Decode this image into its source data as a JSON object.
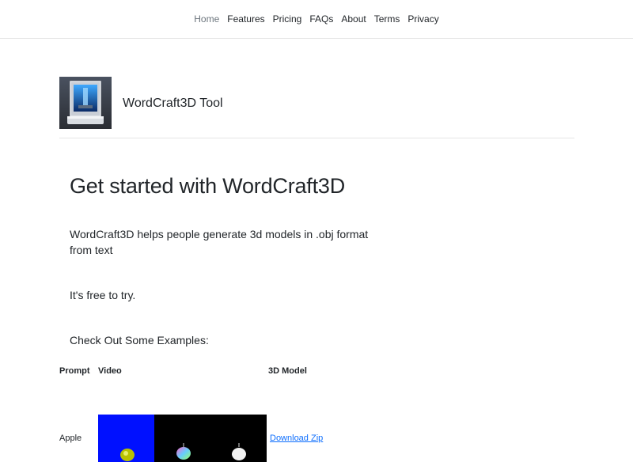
{
  "nav": {
    "items": [
      {
        "label": "Home",
        "active": true
      },
      {
        "label": "Features",
        "active": false
      },
      {
        "label": "Pricing",
        "active": false
      },
      {
        "label": "FAQs",
        "active": false
      },
      {
        "label": "About",
        "active": false
      },
      {
        "label": "Terms",
        "active": false
      },
      {
        "label": "Privacy",
        "active": false
      }
    ]
  },
  "brand": {
    "name": "WordCraft3D Tool",
    "logo_icon": "3d-printer-icon"
  },
  "hero": {
    "title": "Get started with WordCraft3D",
    "description": "WordCraft3D helps people generate 3d models in .obj format from text",
    "free_note": "It's free to try.",
    "examples_heading": "Check Out Some Examples:"
  },
  "examples_table": {
    "headers": {
      "prompt": "Prompt",
      "video": "Video",
      "model": "3D Model"
    },
    "rows": [
      {
        "prompt": "Apple",
        "model_link": "Download Zip"
      }
    ]
  },
  "colors": {
    "link": "#0d6efd",
    "text": "#212529",
    "nav_active": "#6c757d",
    "divider": "#e5e5e5"
  }
}
